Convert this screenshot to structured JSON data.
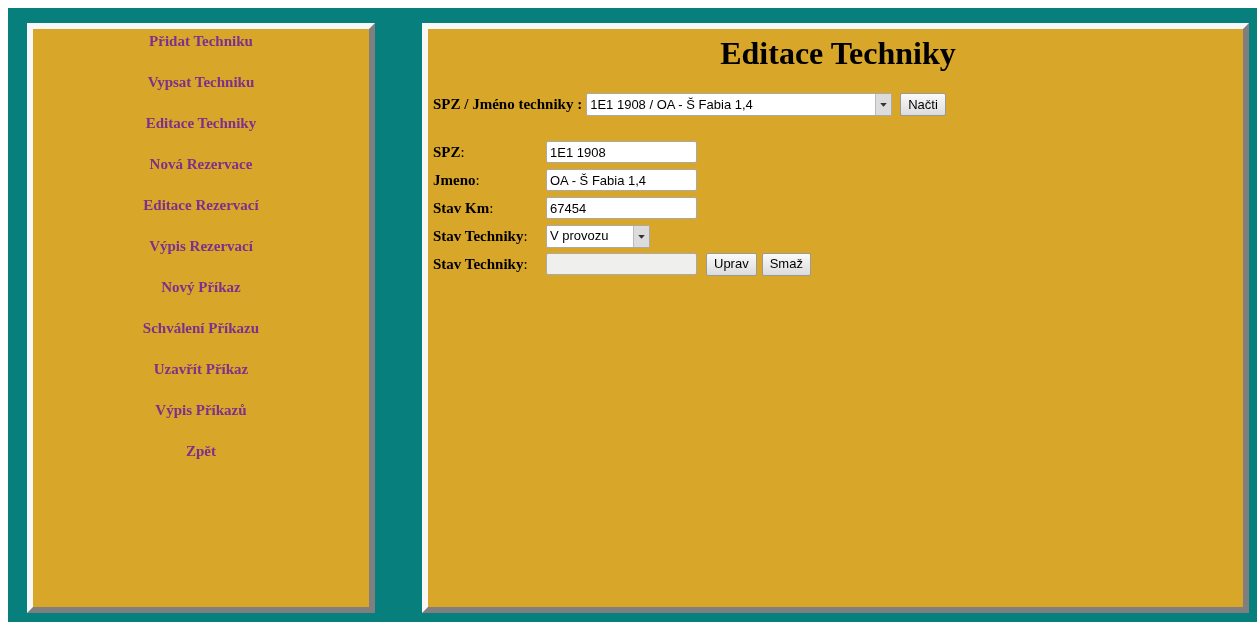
{
  "menu": [
    {
      "label": "Přidat Techniku"
    },
    {
      "label": "Vypsat Techniku"
    },
    {
      "label": "Editace Techniky"
    },
    {
      "label": "Nová Rezervace"
    },
    {
      "label": "Editace Rezervací"
    },
    {
      "label": "Výpis Rezervací"
    },
    {
      "label": "Nový Příkaz"
    },
    {
      "label": "Schválení Příkazu"
    },
    {
      "label": "Uzavřít Příkaz"
    },
    {
      "label": "Výpis Příkazů"
    },
    {
      "label": "Zpět"
    }
  ],
  "title": "Editace Techniky",
  "picker": {
    "label": "SPZ / Jméno techniky :",
    "value": "1E1 1908 / OA - Š Fabia 1,4",
    "button": "Načti"
  },
  "fields": [
    {
      "kind": "input",
      "label": "**SPZ**:",
      "value": "1E1 1908",
      "disabled": false
    },
    {
      "kind": "input",
      "label": "**Jmeno**:",
      "value": "OA - Š Fabia 1,4",
      "disabled": false
    },
    {
      "kind": "input",
      "label": "**Stav Km**:",
      "value": "67454",
      "disabled": false
    },
    {
      "kind": "select",
      "label": "**Stav Techniky**:",
      "value": "V provozu"
    },
    {
      "kind": "input",
      "label": "**Stav Techniky**:",
      "disabled": true,
      "buttons": [
        "Uprav",
        "Smaž"
      ]
    }
  ]
}
